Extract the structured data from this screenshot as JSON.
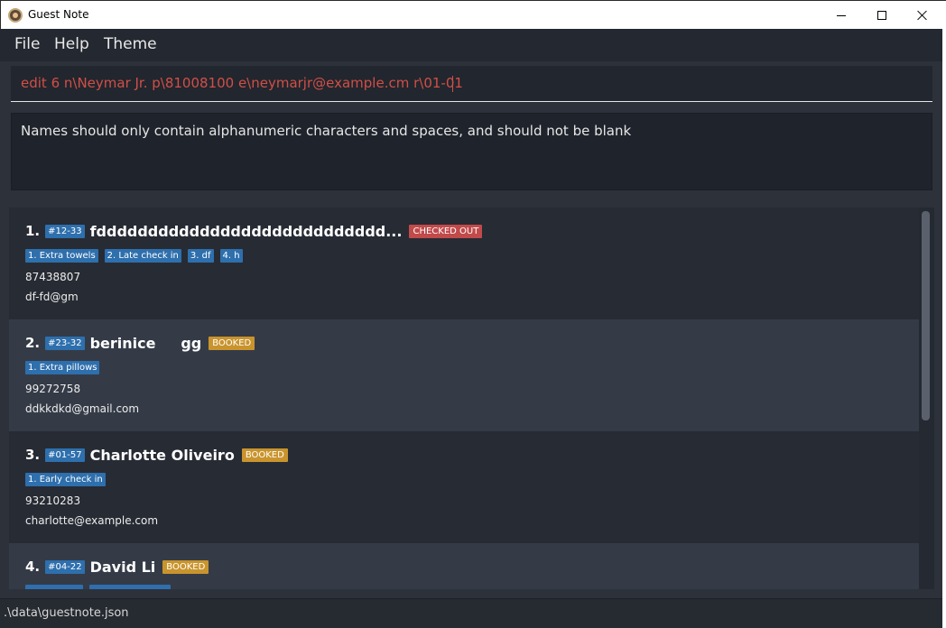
{
  "window": {
    "title": "Guest Note"
  },
  "menu": {
    "file": "File",
    "help": "Help",
    "theme": "Theme"
  },
  "command": {
    "value": "edit 6 n\\Neymar Jr. p\\81008100 e\\neymarjr@example.cm r\\01-01"
  },
  "result": {
    "message": "Names should only contain alphanumeric characters and spaces, and should not be blank"
  },
  "guests": [
    {
      "index": "1.",
      "room": "#12-33",
      "name": "fdddddddddddddddddddddddddddd...",
      "status": "CHECKED OUT",
      "requests": [
        "1. Extra towels",
        "2. Late check in",
        "3. df",
        "4. h"
      ],
      "phone": "87438807",
      "email": "df-fd@gm"
    },
    {
      "index": "2.",
      "room": "#23-32",
      "name": "berinice     gg",
      "status": "BOOKED",
      "requests": [
        "1. Extra pillows"
      ],
      "phone": "99272758",
      "email": "ddkkdkd@gmail.com"
    },
    {
      "index": "3.",
      "room": "#01-57",
      "name": "Charlotte Oliveiro",
      "status": "BOOKED",
      "requests": [
        "1. Early check in"
      ],
      "phone": "93210283",
      "email": "charlotte@example.com"
    },
    {
      "index": "4.",
      "room": "#04-22",
      "name": "David Li",
      "status": "BOOKED",
      "requests": [],
      "phone": "",
      "email": ""
    }
  ],
  "statusbar": {
    "path": ".\\data\\guestnote.json"
  },
  "colors": {
    "status_checked_out": "#c14a4a",
    "status_booked": "#c9942d",
    "tag_blue": "#2e6fad",
    "command_error_text": "#d14f47"
  },
  "icons": {
    "app": "guest-note-app-icon",
    "minimize": "minimize-icon",
    "maximize": "maximize-icon",
    "close": "close-icon"
  }
}
